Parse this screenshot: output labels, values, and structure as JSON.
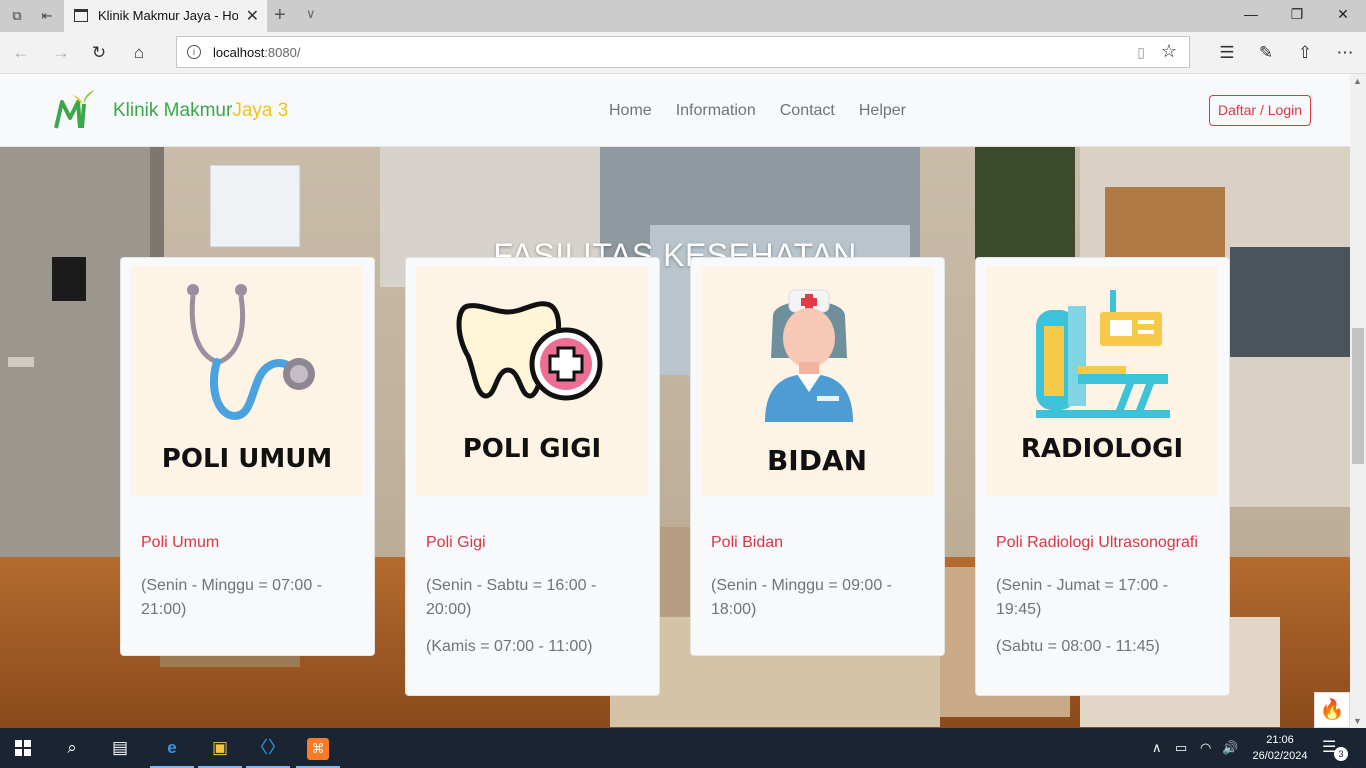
{
  "browser": {
    "tab_title": "Klinik Makmur Jaya - Ho",
    "url_host": "localhost",
    "url_rest": ":8080/"
  },
  "site": {
    "brand_part1": "Klinik Makmur",
    "brand_part2": "Jaya 3",
    "brand_colors": {
      "part1": "#3aa84a",
      "part2": "#f2c21b"
    },
    "nav": [
      "Home",
      "Information",
      "Contact",
      "Helper"
    ],
    "login_label": "Daftar / Login",
    "accent": "#dc3545"
  },
  "hero": {
    "title": "FASILITAS KESEHATAN"
  },
  "cards": [
    {
      "image_label": "POLI UMUM",
      "icon": "stethoscope-icon",
      "title": "Poli Umum",
      "schedule": "(Senin - Minggu = 07:00 - 21:00)",
      "schedule_extra": ""
    },
    {
      "image_label": "POLI GIGI",
      "icon": "tooth-icon",
      "title": "Poli Gigi",
      "schedule": "(Senin - Sabtu = 16:00 - 20:00)",
      "schedule_extra": "(Kamis = 07:00 - 11:00)"
    },
    {
      "image_label": "BIDAN",
      "icon": "nurse-icon",
      "title": "Poli Bidan",
      "schedule": "(Senin - Minggu = 09:00 - 18:00)",
      "schedule_extra": ""
    },
    {
      "image_label": "RADIOLOGI",
      "icon": "radiology-icon",
      "title": "Poli Radiologi Ultrasonografi",
      "schedule": "(Senin - Jumat = 17:00 - 19:45)",
      "schedule_extra": "(Sabtu = 08:00 - 11:45)"
    }
  ],
  "taskbar": {
    "time": "21:06",
    "date": "26/02/2024",
    "notification_count": "3"
  }
}
